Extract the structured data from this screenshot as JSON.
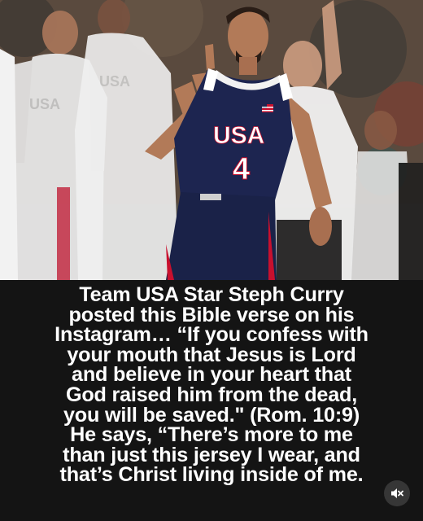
{
  "photo": {
    "jersey_text": "USA",
    "jersey_number": "4",
    "bench_jersey_text_1": "USA",
    "bench_jersey_text_2": "USA"
  },
  "caption": {
    "lines": [
      "Team USA Star Steph Curry",
      "posted this Bible verse on his",
      "Instagram… “If you confess with",
      "your mouth that Jesus is Lord",
      "and believe in your heart that",
      "God raised him from the dead,",
      "you will be saved.\" (Rom. 10:9)",
      "He says, “There’s more to me",
      "than just this jersey I wear, and",
      "that’s Christ living inside of me."
    ]
  },
  "controls": {
    "mute_icon": "speaker-muted-icon"
  },
  "colors": {
    "caption_bg": "#141414",
    "caption_text": "#ffffff",
    "jersey_navy": "#1d2550",
    "jersey_trim": "#c8102e"
  }
}
